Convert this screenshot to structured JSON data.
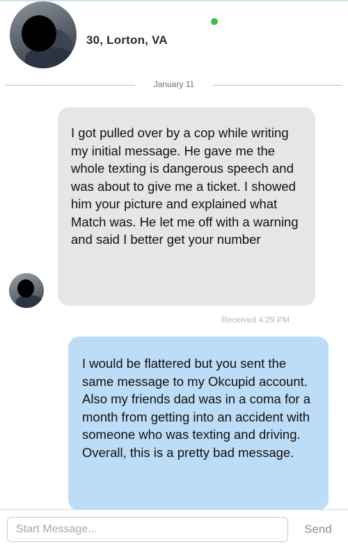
{
  "header": {
    "profile_info": "30, Lorton, VA",
    "online_status_color": "#3fbf4a"
  },
  "conversation": {
    "date": "January 11",
    "messages": [
      {
        "direction": "received",
        "text": "I got pulled over by a cop while writing my initial message. He gave me the whole texting is dangerous speech and was about to give me a ticket. I showed him your picture and explained what Match was. He let me off with a warning and said I better get your number",
        "status": "Received 4:29 PM"
      },
      {
        "direction": "sent",
        "text": "I would be flattered but you sent the same message to my Okcupid account. Also my friends dad was in a coma for a month from getting into an accident with someone who was texting and driving. Overall, this is a pretty bad message."
      }
    ]
  },
  "composer": {
    "placeholder": "Start Message...",
    "send_label": "Send"
  },
  "colors": {
    "received_bubble": "#e6e6e8",
    "sent_bubble": "#bcdcf7"
  }
}
